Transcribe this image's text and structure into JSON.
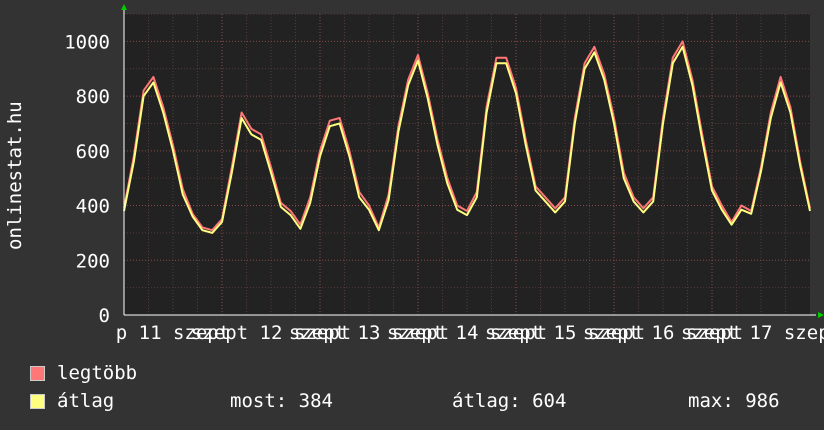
{
  "chart_data": {
    "type": "line",
    "ylabel": "onlinestat.hu",
    "ylim": [
      0,
      1100
    ],
    "yticks": [
      0,
      200,
      400,
      600,
      800,
      1000
    ],
    "xlim": [
      0,
      7
    ],
    "xtick_labels": [
      "p 11 szept",
      "szept 12 szept",
      "szept 13 szept",
      "szept 14 szept",
      "szept 15 szept",
      "szept 16 szept",
      "szept 17 szept"
    ],
    "grid": true,
    "background": "#222222",
    "series": [
      {
        "name": "legtöbb",
        "color": "#ff7777",
        "x": [
          0.0,
          0.1,
          0.2,
          0.3,
          0.4,
          0.5,
          0.6,
          0.7,
          0.8,
          0.9,
          1.0,
          1.1,
          1.2,
          1.3,
          1.4,
          1.5,
          1.6,
          1.7,
          1.8,
          1.9,
          2.0,
          2.1,
          2.2,
          2.3,
          2.4,
          2.5,
          2.6,
          2.7,
          2.8,
          2.9,
          3.0,
          3.1,
          3.2,
          3.3,
          3.4,
          3.5,
          3.6,
          3.7,
          3.8,
          3.9,
          4.0,
          4.1,
          4.2,
          4.3,
          4.4,
          4.5,
          4.6,
          4.7,
          4.8,
          4.9,
          5.0,
          5.1,
          5.2,
          5.3,
          5.4,
          5.5,
          5.6,
          5.7,
          5.8,
          5.9,
          6.0,
          6.1,
          6.2,
          6.3,
          6.4,
          6.5,
          6.6,
          6.7,
          6.8,
          6.9,
          7.0
        ],
        "values": [
          390,
          580,
          820,
          870,
          760,
          620,
          460,
          370,
          320,
          310,
          350,
          540,
          740,
          680,
          660,
          540,
          410,
          380,
          330,
          430,
          600,
          710,
          720,
          600,
          450,
          400,
          320,
          440,
          690,
          860,
          950,
          810,
          640,
          500,
          400,
          380,
          450,
          760,
          940,
          940,
          830,
          640,
          470,
          430,
          390,
          430,
          720,
          920,
          980,
          880,
          720,
          520,
          430,
          390,
          430,
          720,
          940,
          1000,
          860,
          660,
          470,
          400,
          340,
          400,
          380,
          540,
          740,
          870,
          760,
          560,
          390
        ]
      },
      {
        "name": "átlag",
        "color": "#ffff80",
        "x": [
          0.0,
          0.1,
          0.2,
          0.3,
          0.4,
          0.5,
          0.6,
          0.7,
          0.8,
          0.9,
          1.0,
          1.1,
          1.2,
          1.3,
          1.4,
          1.5,
          1.6,
          1.7,
          1.8,
          1.9,
          2.0,
          2.1,
          2.2,
          2.3,
          2.4,
          2.5,
          2.6,
          2.7,
          2.8,
          2.9,
          3.0,
          3.1,
          3.2,
          3.3,
          3.4,
          3.5,
          3.6,
          3.7,
          3.8,
          3.9,
          4.0,
          4.1,
          4.2,
          4.3,
          4.4,
          4.5,
          4.6,
          4.7,
          4.8,
          4.9,
          5.0,
          5.1,
          5.2,
          5.3,
          5.4,
          5.5,
          5.6,
          5.7,
          5.8,
          5.9,
          6.0,
          6.1,
          6.2,
          6.3,
          6.4,
          6.5,
          6.6,
          6.7,
          6.8,
          6.9,
          7.0
        ],
        "values": [
          380,
          560,
          800,
          850,
          740,
          600,
          440,
          360,
          310,
          300,
          340,
          520,
          720,
          660,
          640,
          520,
          395,
          365,
          315,
          410,
          580,
          690,
          700,
          580,
          430,
          385,
          310,
          420,
          670,
          840,
          930,
          790,
          620,
          480,
          385,
          365,
          430,
          740,
          920,
          920,
          810,
          620,
          455,
          415,
          375,
          415,
          700,
          900,
          960,
          860,
          700,
          500,
          415,
          375,
          415,
          700,
          920,
          980,
          840,
          640,
          455,
          385,
          330,
          385,
          370,
          525,
          720,
          850,
          740,
          545,
          380
        ]
      }
    ]
  },
  "legend": [
    {
      "label": "legtöbb",
      "color": "#ff7777"
    },
    {
      "label": "átlag",
      "color": "#ffff80"
    }
  ],
  "stats": {
    "most": "most: 384",
    "atlag": "átlag: 604",
    "max": "max: 986"
  }
}
